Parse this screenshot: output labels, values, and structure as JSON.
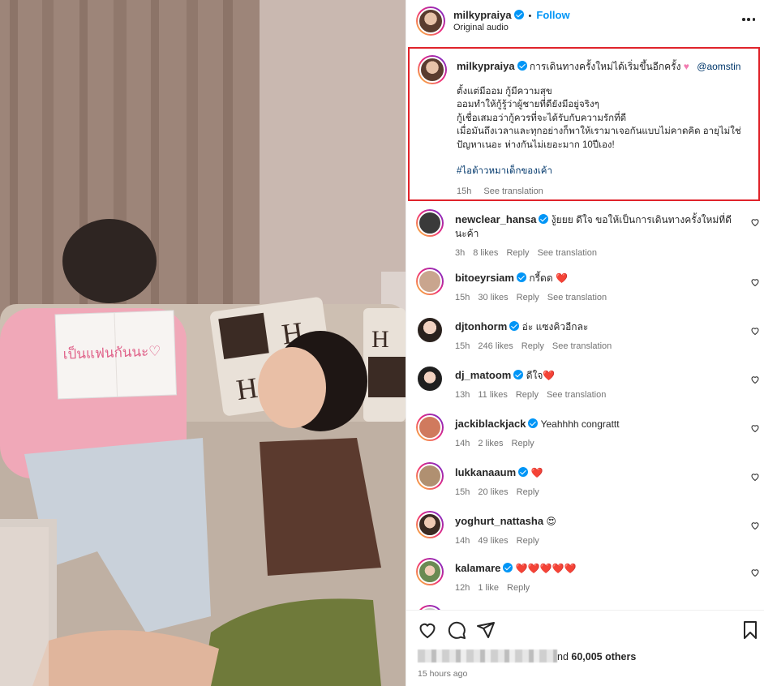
{
  "post": {
    "author": "milkypraiya",
    "follow_label": "Follow",
    "separator": "•",
    "audio": "Original audio"
  },
  "caption": {
    "author": "milkypraiya",
    "headline": "การเดินทางครั้งใหม่ได้เริ่มขึ้นอีกครั้ง",
    "mention": "@aomstin",
    "body": "ตั้งแต่มีออม กู้มีความสุข\nออมทำให้กู้รู้ว่าผู้ชายที่ดียังมีอยู่จริงๆ\nกู้เชื่อเสมอว่ากู้ควรที่จะได้รับกับความรักที่ดี\nเมื่อมันถึงเวลาและทุกอย่างก็พาให้เรามาเจอกันแบบไม่คาดคิด อายุไม่ใช่ปัญหาเนอะ ห่างกันไม่เยอะมาก 10ปีเอง!",
    "hashtag": "#ไอต้าวหมาเด็กของเค้า",
    "time": "15h",
    "see_translation": "See translation"
  },
  "comments": [
    {
      "user": "newclear_hansa",
      "text": "งู้ยยย ดีใจ ขอให้เป็นการเดินทางครั้งใหม่ที่ดีนะค้า",
      "time": "3h",
      "likes": "8 likes",
      "reply": "Reply",
      "translate": "See translation"
    },
    {
      "user": "bitoeyrsiam",
      "text": "กรี้ดด ❤️",
      "time": "15h",
      "likes": "30 likes",
      "reply": "Reply",
      "translate": "See translation"
    },
    {
      "user": "djtonhorm",
      "text": "อ่ะ แซงคิวอีกละ",
      "time": "15h",
      "likes": "246 likes",
      "reply": "Reply",
      "translate": "See translation"
    },
    {
      "user": "dj_matoom",
      "text": "ดีใจ❤️",
      "time": "13h",
      "likes": "11 likes",
      "reply": "Reply",
      "translate": "See translation"
    },
    {
      "user": "jackiblackjack",
      "text": "Yeahhhh congrattt",
      "time": "14h",
      "likes": "2 likes",
      "reply": "Reply",
      "translate": ""
    },
    {
      "user": "lukkanaaum",
      "text": "❤️",
      "time": "15h",
      "likes": "20 likes",
      "reply": "Reply",
      "translate": ""
    },
    {
      "user": "yoghurt_nattasha",
      "text": "😍",
      "time": "14h",
      "likes": "49 likes",
      "reply": "Reply",
      "translate": ""
    },
    {
      "user": "kalamare",
      "text": "❤️❤️❤️❤️❤️",
      "time": "12h",
      "likes": "1 like",
      "reply": "Reply",
      "translate": ""
    }
  ],
  "footer": {
    "likes_prefix": "nd",
    "likes_count": "60,005 others",
    "time": "15 hours ago"
  },
  "media": {
    "sign_text": "เป็นแฟนกันนะ♡"
  },
  "colors": {
    "accent": "#0095f6",
    "highlight_border": "#e0242b",
    "heart": "#ed4956"
  }
}
